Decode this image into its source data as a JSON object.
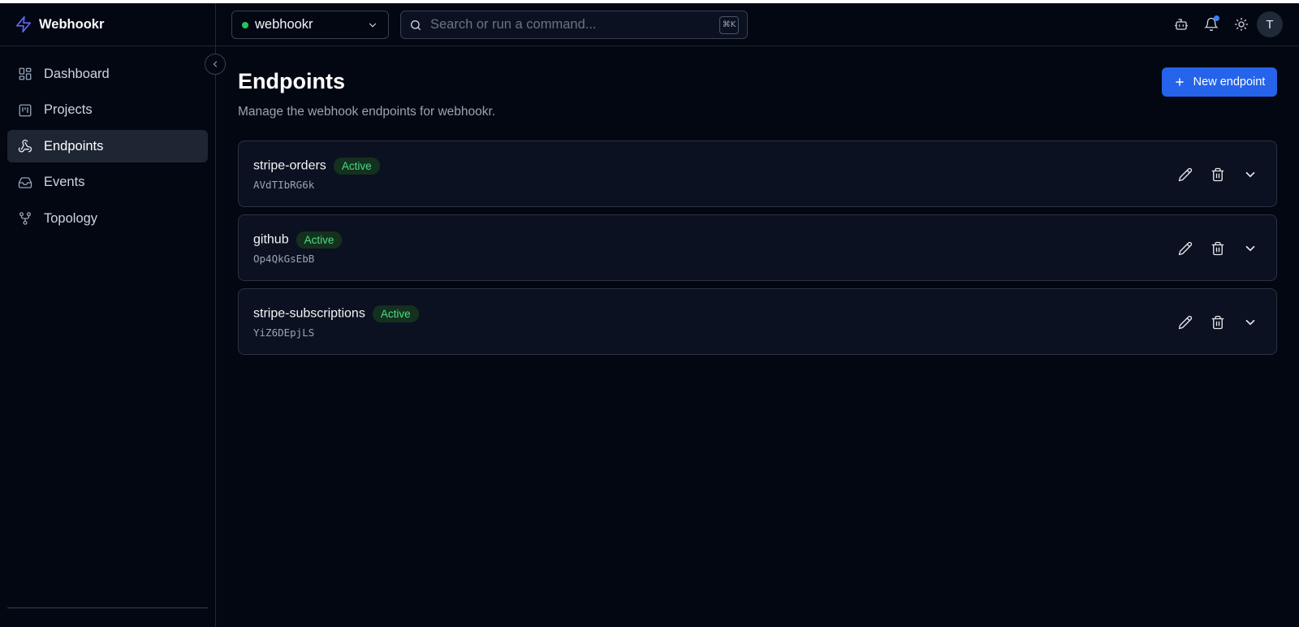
{
  "brand": {
    "name": "Webhookr"
  },
  "sidebar": {
    "items": [
      {
        "label": "Dashboard",
        "icon": "layout-dashboard-icon",
        "active": false
      },
      {
        "label": "Projects",
        "icon": "kanban-icon",
        "active": false
      },
      {
        "label": "Endpoints",
        "icon": "webhook-icon",
        "active": true
      },
      {
        "label": "Events",
        "icon": "inbox-icon",
        "active": false
      },
      {
        "label": "Topology",
        "icon": "git-fork-icon",
        "active": false
      }
    ]
  },
  "topbar": {
    "project": "webhookr",
    "search_placeholder": "Search or run a command...",
    "shortcut": "⌘K",
    "avatar_initial": "T"
  },
  "page": {
    "title": "Endpoints",
    "subtitle": "Manage the webhook endpoints for webhookr.",
    "new_button": "New endpoint"
  },
  "endpoints": [
    {
      "name": "stripe-orders",
      "status": "Active",
      "id": "AVdTIbRG6k"
    },
    {
      "name": "github",
      "status": "Active",
      "id": "Op4QkGsEbB"
    },
    {
      "name": "stripe-subscriptions",
      "status": "Active",
      "id": "YiZ6DEpjLS"
    }
  ],
  "colors": {
    "background": "#030712",
    "accent": "#2563eb",
    "active_status": "#4ade80",
    "brand_icon": "#6366f1"
  }
}
